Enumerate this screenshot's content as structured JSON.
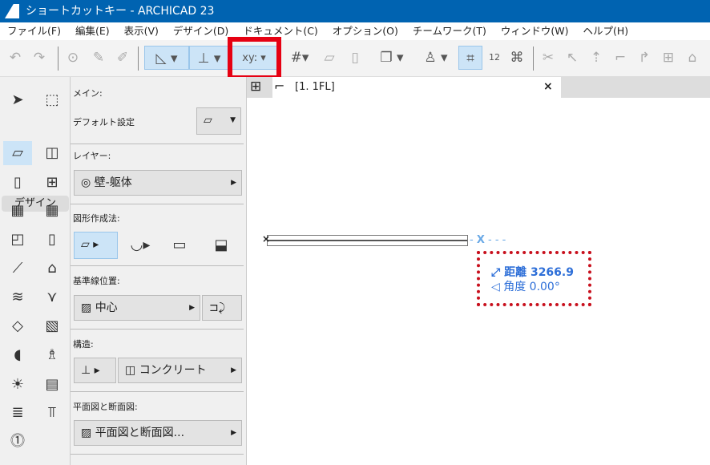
{
  "window": {
    "title": "ショートカットキー - ARCHICAD 23"
  },
  "menu": [
    "ファイル(F)",
    "編集(E)",
    "表示(V)",
    "デザイン(D)",
    "ドキュメント(C)",
    "オプション(O)",
    "チームワーク(T)",
    "ウィンドウ(W)",
    "ヘルプ(H)"
  ],
  "toolbox": {
    "section": "デザイン"
  },
  "info": {
    "main_label": "メイン:",
    "default_label": "デフォルト設定",
    "layer_label": "レイヤー:",
    "layer_value": "壁-躯体",
    "geometry_label": "図形作成法:",
    "refline_label": "基準線位置:",
    "refline_value": "中心",
    "structure_label": "構造:",
    "structure_value": "コンクリート",
    "floorplan_label": "平面図と断面図:",
    "floorplan_value": "平面図と断面図..."
  },
  "tab": {
    "label": "[1. 1FL]",
    "close": "×"
  },
  "tracker": {
    "distance_label": "距離",
    "distance_value": "3266.9",
    "angle_label": "角度",
    "angle_value": "0.00°",
    "axis": "X"
  },
  "colors": {
    "titlebar": "#0063b1",
    "highlight": "#e60012",
    "tracker": "#2e6fd8"
  }
}
